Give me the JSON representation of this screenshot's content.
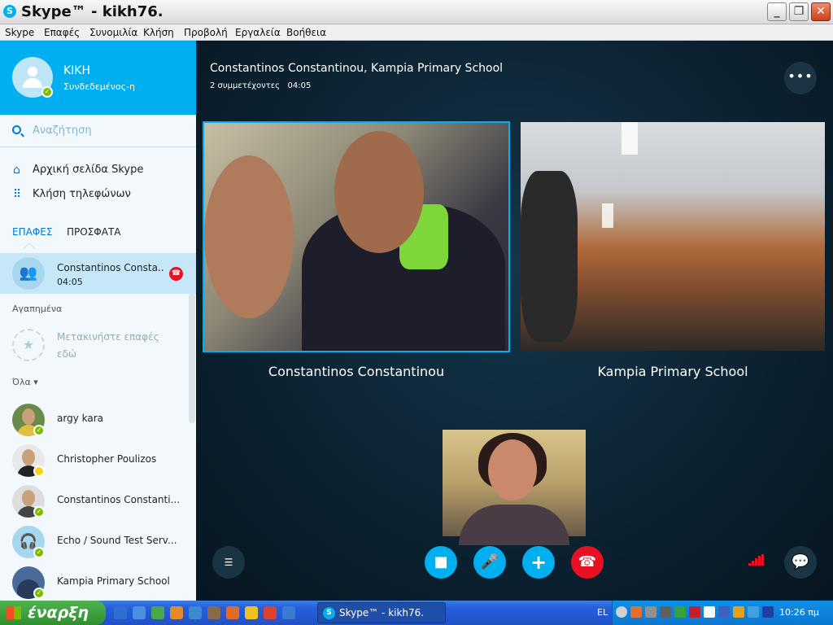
{
  "window": {
    "title": "Skype™ - kikh76.",
    "icon": "skype-icon"
  },
  "menu": [
    "Skype",
    "Επαφές",
    "Συνομιλία",
    "Κλήση",
    "Προβολή",
    "Εργαλεία",
    "Βοήθεια"
  ],
  "profile": {
    "name": "ΚΙΚΗ",
    "status": "Συνδεδεμένος-η"
  },
  "search": {
    "placeholder": "Αναζήτηση"
  },
  "nav": {
    "home": "Αρχική σελίδα Skype",
    "call_phones": "Κλήση τηλεφώνων"
  },
  "tabs": {
    "contacts": "ΕΠΑΦΕΣ",
    "recent": "ΠΡΟΣΦΑΤΑ"
  },
  "active_call": {
    "name": "Constantinos Consta...",
    "time": "04:05"
  },
  "favorites": {
    "header": "Αγαπημένα",
    "hint": "Μετακινήστε επαφές εδώ"
  },
  "all": {
    "header": "Όλα ▾"
  },
  "contacts": [
    {
      "name": "argy kara",
      "status": "online"
    },
    {
      "name": "Christopher Poulizos",
      "status": "away"
    },
    {
      "name": "Constantinos Constanti...",
      "status": "online"
    },
    {
      "name": "Echo / Sound Test Serv...",
      "status": "online"
    },
    {
      "name": "Kampia Primary School",
      "status": "online"
    }
  ],
  "call": {
    "title": "Constantinos Constantinou, Kampia Primary School",
    "participants": "2 συμμετέχοντες",
    "duration": "04:05",
    "video_names": [
      "Constantinos Constantinou",
      "Kampia Primary School"
    ]
  },
  "taskbar": {
    "start": "έναρξη",
    "active_task": "Skype™ - kikh76.",
    "language": "EL",
    "clock": "10:26 πμ"
  },
  "colors": {
    "skype_blue": "#00aff0",
    "hangup_red": "#e81123",
    "online_green": "#7fba00",
    "away_yellow": "#fcd116"
  }
}
